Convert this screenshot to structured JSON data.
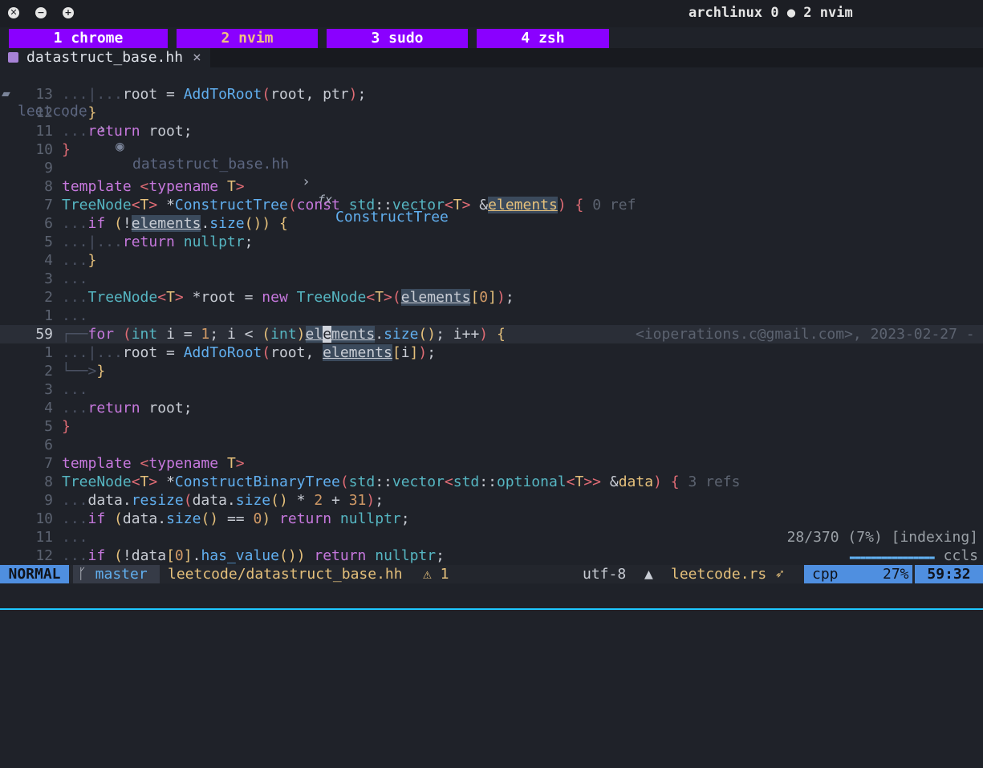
{
  "window": {
    "title": "archlinux 0 ● 2 nvim",
    "buttons": [
      "close",
      "minimize",
      "maximize"
    ]
  },
  "tmux": {
    "tabs": [
      {
        "label": "1 chrome",
        "active": false
      },
      {
        "label": "2 nvim",
        "active": true
      },
      {
        "label": "3 sudo",
        "active": false
      },
      {
        "label": "4 zsh",
        "active": false
      }
    ]
  },
  "buffer": {
    "name": "datastruct_base.hh",
    "close": "×"
  },
  "breadcrumb": {
    "folder": "leetcode",
    "sep": "›",
    "file": "datastruct_base.hh",
    "fn_icon": "fx",
    "func": "ConstructTree"
  },
  "editor": {
    "cursor_line": "59",
    "blame": "<ioperations.c@gmail.com>, 2023-02-27 -",
    "construct_refs": "0 ref",
    "binary_refs": "3 refs",
    "lsp_progress": "28/370 (7%) [indexing]",
    "lsp_name": "ccls",
    "lsp_bar": "▬▬▬▬▬▬▬▬▬▬▬▬▬▬▬▬"
  },
  "status": {
    "mode": "NORMAL",
    "branch": "master",
    "file": "leetcode/datastruct_base.hh",
    "warnings": "⚠ 1",
    "encoding": "utf-8",
    "os_icon": "linux-icon",
    "project": "leetcode.rs",
    "project_icon": "rocket-icon",
    "filetype": "cpp",
    "percent": "27%",
    "position": "59:32"
  },
  "colors": {
    "tab_bg": "#8a00ff",
    "mode_bg": "#4f8fe0",
    "accent_line": "#1ec8ff"
  }
}
